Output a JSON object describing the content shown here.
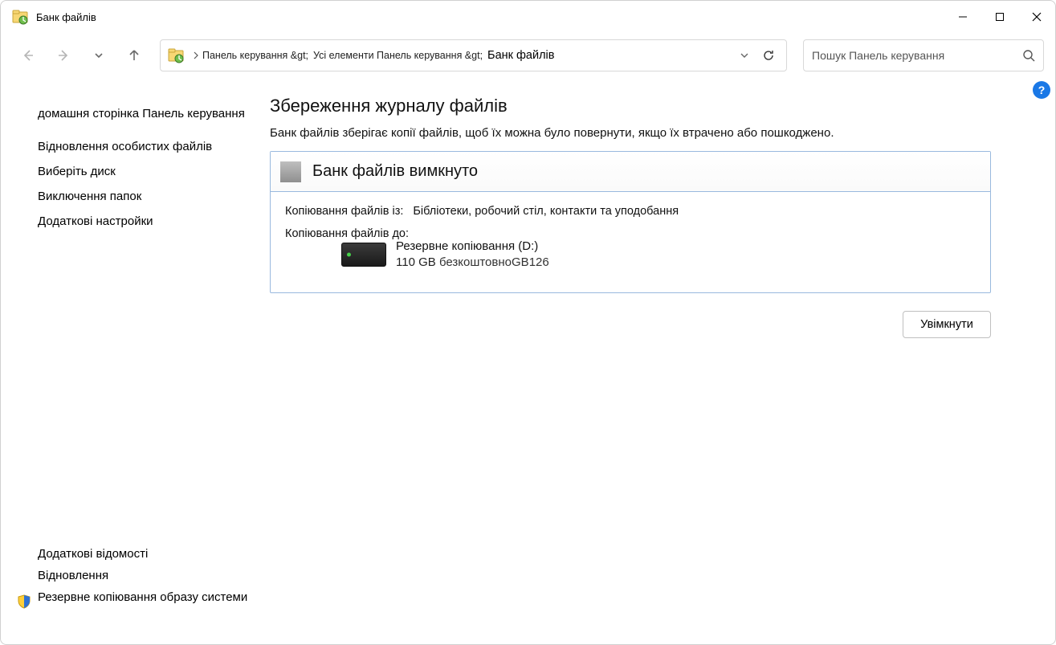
{
  "window": {
    "title": "Банк файлів"
  },
  "breadcrumb": {
    "parts": [
      "Панель керування &gt;",
      "Усі елементи Панель керування &gt;",
      "Банк файлів"
    ]
  },
  "search": {
    "placeholder": "Пошук Панель керування"
  },
  "sidebar": {
    "home": "домашня сторінка Панель керування",
    "items": [
      "Відновлення особистих файлів",
      "Виберіть диск",
      "Виключення папок",
      "Додаткові настройки"
    ],
    "bottom": {
      "see_also": "Додаткові відомості",
      "recovery": "Відновлення",
      "system_image": "Резервне копіювання образу системи"
    }
  },
  "content": {
    "page_title": "Збереження журналу файлів",
    "page_desc": "Банк файлів зберігає копії файлів, щоб їх можна було повернути, якщо їх втрачено або пошкоджено.",
    "status_header": "Банк файлів вимкнуто",
    "copy_from_label": "Копіювання файлів із:",
    "copy_from_value": "Бібліотеки, робочий стіл, контакти та уподобання",
    "copy_to_label": "Копіювання файлів до:",
    "drive": {
      "name": "Резервне копіювання (D:)",
      "space_free": "110 GB",
      "space_mid": "безкоштовно",
      "space_of": "GB",
      "space_total": "126"
    },
    "enable_button": "Увімкнути"
  }
}
